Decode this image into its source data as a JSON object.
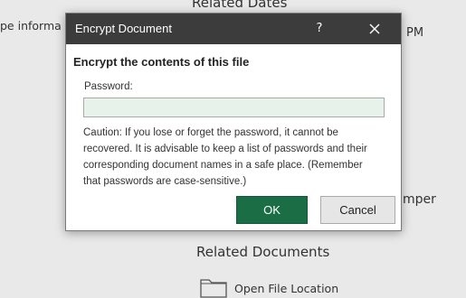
{
  "background": {
    "top_heading": "Related Dates",
    "left_partial_text": "pe informa",
    "right_partial_time": "PM",
    "right_partial_name": "mper",
    "related_documents_heading": "Related Documents",
    "open_file_location": "Open File Location"
  },
  "dialog": {
    "title": "Encrypt Document",
    "help_label": "?",
    "heading": "Encrypt the contents of this file",
    "password_label": "Password:",
    "password_value": "",
    "caution": "Caution: If you lose or forget the password, it cannot be recovered. It is advisable to keep a list of passwords and their corresponding document names in a safe place. (Remember that passwords are case-sensitive.)",
    "ok_label": "OK",
    "cancel_label": "Cancel"
  },
  "colors": {
    "titlebar": "#3c3c3c",
    "ok_button": "#1b6d46",
    "input_background": "#e6f2ea"
  },
  "icons": {
    "close": "close-icon",
    "folder": "folder-icon"
  }
}
